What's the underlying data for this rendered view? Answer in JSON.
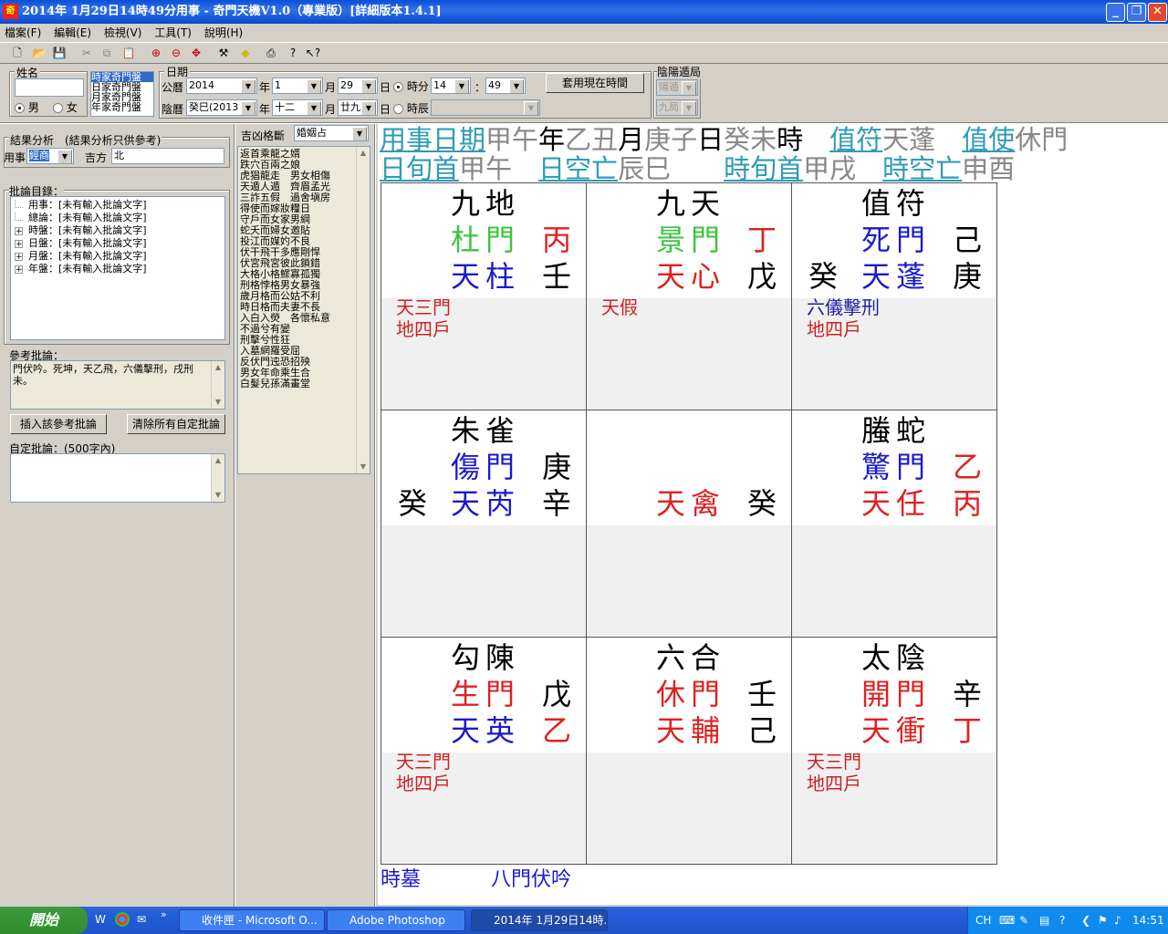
{
  "window": {
    "title": "2014年 1月29日14時49分用事 - 奇門天機V1.0（專業版）[詳細版本1.4.1]",
    "app_icon": "奇"
  },
  "menu": [
    "檔案(F)",
    "編輯(E)",
    "檢視(V)",
    "工具(T)",
    "說明(H)"
  ],
  "form": {
    "name_label": "姓名",
    "name_value": "",
    "male_label": "男",
    "female_label": "女",
    "plate_list": [
      "時家奇門盤",
      "日家奇門盤",
      "月家奇門盤",
      "年家奇門盤"
    ],
    "date_label": "日期",
    "solar_label": "公曆",
    "solar_year": "2014",
    "year_char": "年",
    "solar_month": "1",
    "month_char": "月",
    "solar_day": "29",
    "day_char": "日",
    "hour_label": "時分",
    "hour_value": "14",
    "colon": "：",
    "minute_value": "49",
    "now_button": "套用現在時間",
    "lunar_label": "陰曆",
    "lunar_year": "癸巳(2013",
    "lunar_month": "十二",
    "lunar_day": "廿九",
    "shichen_label": "時辰",
    "shichen_value": "",
    "dun_label": "陰陽遁局",
    "dun_value": "陽遁",
    "ju_value": "九局"
  },
  "left": {
    "analysis_title": "結果分析　(結果分析只供參考)",
    "yongshi_label": "用事",
    "yongshi_value": "經商",
    "jifang_label": "吉方",
    "jifang_value": "北",
    "catalog_label": "批論目錄：",
    "tree": [
      {
        "expander": "",
        "text": "用事：[未有輸入批論文字]"
      },
      {
        "expander": "",
        "text": "總論：[未有輸入批論文字]"
      },
      {
        "expander": "+",
        "text": "時盤：[未有輸入批論文字]"
      },
      {
        "expander": "+",
        "text": "日盤：[未有輸入批論文字]"
      },
      {
        "expander": "+",
        "text": "月盤：[未有輸入批論文字]"
      },
      {
        "expander": "+",
        "text": "年盤：[未有輸入批論文字]"
      }
    ],
    "ref_label": "參考批論：",
    "ref_text": "門伏吟。死坤，天乙飛，六儀擊刑，戌刑未。",
    "insert_button": "插入該參考批論",
    "clear_button": "清除所有自定批論",
    "custom_label": "自定批論：(500字內)",
    "custom_value": ""
  },
  "middle": {
    "label": "吉凶格斷",
    "select_value": "婚姻占",
    "items": [
      "返首乘龍之婿",
      "跌穴百兩之娘",
      "虎猖龍走　男女相傷",
      "天遁人遁　齊眉孟光",
      "三詐五假　過舍塡房",
      "得使而嫁妝糧日",
      "守戶而女家男綱",
      "蛇夭而婦女邀貼",
      "投江而媒妁不良",
      "伏干飛干多應剛悍",
      "伏宮飛宮彼此鎖錯",
      "大格小格鰥寡孤獨",
      "刑格悖格男女暴強",
      "歲月格而公姑不利",
      "時日格而夫妻不長",
      "入白入熒　各懷私意",
      "不過兮有變",
      "刑擊兮性狂",
      "入墓網羅受屈",
      "反伏門迍恐招殃",
      "男女年命乘生合",
      "白髮兒孫滿畫堂"
    ]
  },
  "chart": {
    "line1": [
      {
        "t": "用事日期",
        "c": "link"
      },
      {
        "t": "甲午",
        "c": "gray"
      },
      {
        "t": "年",
        "c": ""
      },
      {
        "t": "乙丑",
        "c": "gray"
      },
      {
        "t": "月",
        "c": ""
      },
      {
        "t": "庚子",
        "c": "gray"
      },
      {
        "t": "日",
        "c": ""
      },
      {
        "t": "癸未",
        "c": "gray"
      },
      {
        "t": "時",
        "c": ""
      },
      {
        "t": "　",
        "c": ""
      },
      {
        "t": "值符",
        "c": "link"
      },
      {
        "t": "天蓬",
        "c": "gray"
      },
      {
        "t": "　",
        "c": ""
      },
      {
        "t": "值使",
        "c": "link"
      },
      {
        "t": "休門",
        "c": "gray"
      }
    ],
    "line2": [
      {
        "t": "日旬首",
        "c": "link"
      },
      {
        "t": "甲午",
        "c": "gray"
      },
      {
        "t": "　",
        "c": ""
      },
      {
        "t": "日空亡",
        "c": "link"
      },
      {
        "t": "辰巳",
        "c": "gray"
      },
      {
        "t": "　　",
        "c": ""
      },
      {
        "t": "時旬首",
        "c": "link"
      },
      {
        "t": "甲戌",
        "c": "gray"
      },
      {
        "t": "　",
        "c": ""
      },
      {
        "t": "時空亡",
        "c": "link"
      },
      {
        "t": "申酉",
        "c": "gray"
      }
    ],
    "colors": {
      "black": "#000000",
      "red": "#e02020",
      "green": "#3cc43c",
      "blue": "#1a1acc",
      "note_red": "#cc2222",
      "note_blue": "#2020a0"
    },
    "cells": [
      {
        "god": "九地",
        "door": "杜門",
        "door_c": "green",
        "door_stem": "丙",
        "door_stem_c": "red",
        "left_stem": "",
        "star": "天柱",
        "star_c": "blue",
        "star_stem": "壬",
        "star_stem_c": "black",
        "notes": [
          {
            "t": "天三門",
            "c": "note_red"
          },
          {
            "t": "地四戶",
            "c": "note_red"
          }
        ]
      },
      {
        "god": "九天",
        "door": "景門",
        "door_c": "green",
        "door_stem": "丁",
        "door_stem_c": "red",
        "left_stem": "",
        "star": "天心",
        "star_c": "red",
        "star_stem": "戊",
        "star_stem_c": "black",
        "notes": [
          {
            "t": "天假",
            "c": "note_red"
          }
        ]
      },
      {
        "god": "值符",
        "door": "死門",
        "door_c": "blue",
        "door_stem": "己",
        "door_stem_c": "black",
        "left_stem": "癸",
        "star": "天蓬",
        "star_c": "blue",
        "star_stem": "庚",
        "star_stem_c": "black",
        "notes": [
          {
            "t": "六儀擊刑",
            "c": "note_blue"
          },
          {
            "t": "地四戶",
            "c": "note_red"
          }
        ]
      },
      {
        "god": "朱雀",
        "door": "傷門",
        "door_c": "blue",
        "door_stem": "庚",
        "door_stem_c": "black",
        "left_stem": "癸",
        "star": "天芮",
        "star_c": "blue",
        "star_stem": "辛",
        "star_stem_c": "black",
        "notes": []
      },
      {
        "god": "",
        "door": "",
        "door_c": "black",
        "door_stem": "",
        "door_stem_c": "black",
        "left_stem": "",
        "star": "天禽",
        "star_c": "red",
        "star_stem": "癸",
        "star_stem_c": "black",
        "notes": []
      },
      {
        "god": "螣蛇",
        "door": "驚門",
        "door_c": "blue",
        "door_stem": "乙",
        "door_stem_c": "red",
        "left_stem": "",
        "star": "天任",
        "star_c": "red",
        "star_stem": "丙",
        "star_stem_c": "red",
        "notes": []
      },
      {
        "god": "勾陳",
        "door": "生門",
        "door_c": "red",
        "door_stem": "戊",
        "door_stem_c": "black",
        "left_stem": "",
        "star": "天英",
        "star_c": "blue",
        "star_stem": "乙",
        "star_stem_c": "red",
        "notes": [
          {
            "t": "天三門",
            "c": "note_red"
          },
          {
            "t": "地四戶",
            "c": "note_red"
          }
        ]
      },
      {
        "god": "六合",
        "door": "休門",
        "door_c": "red",
        "door_stem": "壬",
        "door_stem_c": "black",
        "left_stem": "",
        "star": "天輔",
        "star_c": "red",
        "star_stem": "己",
        "star_stem_c": "black",
        "notes": []
      },
      {
        "god": "太陰",
        "door": "開門",
        "door_c": "red",
        "door_stem": "辛",
        "door_stem_c": "black",
        "left_stem": "",
        "star": "天衝",
        "star_c": "red",
        "star_stem": "丁",
        "star_stem_c": "red",
        "notes": [
          {
            "t": "天三門",
            "c": "note_red"
          },
          {
            "t": "地四戶",
            "c": "note_red"
          }
        ]
      }
    ],
    "footer_left": "時墓",
    "footer_right": "八門伏吟"
  },
  "taskbar": {
    "start": "開始",
    "tasks": [
      "收件匣 - Microsoft O...",
      "Adobe Photoshop",
      "2014年 1月29日14時..."
    ],
    "lang": "CH",
    "clock": "14:51"
  }
}
